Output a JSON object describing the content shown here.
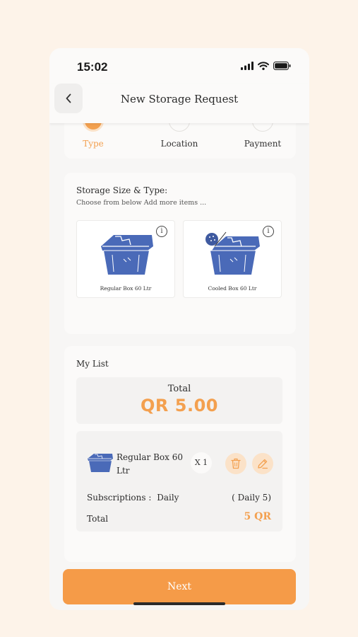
{
  "status": {
    "time": "15:02"
  },
  "header": {
    "title": "New Storage Request"
  },
  "steps": [
    {
      "label": "Type",
      "active": true
    },
    {
      "label": "Location",
      "active": false
    },
    {
      "label": "Payment",
      "active": false
    }
  ],
  "storage": {
    "title": "Storage Size & Type:",
    "subtitle": "Choose from below Add more items ...",
    "options": [
      {
        "label": "Regular Box 60 Ltr",
        "icon": "regular-box-icon"
      },
      {
        "label": "Cooled Box 60 Ltr",
        "icon": "cooled-box-icon"
      }
    ]
  },
  "my_list": {
    "title": "My List",
    "total_label": "Total",
    "total_value": "QR 5.00",
    "item": {
      "name": "Regular Box 60 Ltr",
      "quantity": "X 1",
      "subscription_label": "Subscriptions :",
      "subscription_value": "Daily",
      "subscription_detail": "( Daily 5)",
      "total_label": "Total",
      "total_value": "5 QR"
    }
  },
  "next_button": "Next",
  "colors": {
    "accent": "#f3a04f",
    "box_blue": "#4a6ab8",
    "background": "#fdf3e9"
  }
}
